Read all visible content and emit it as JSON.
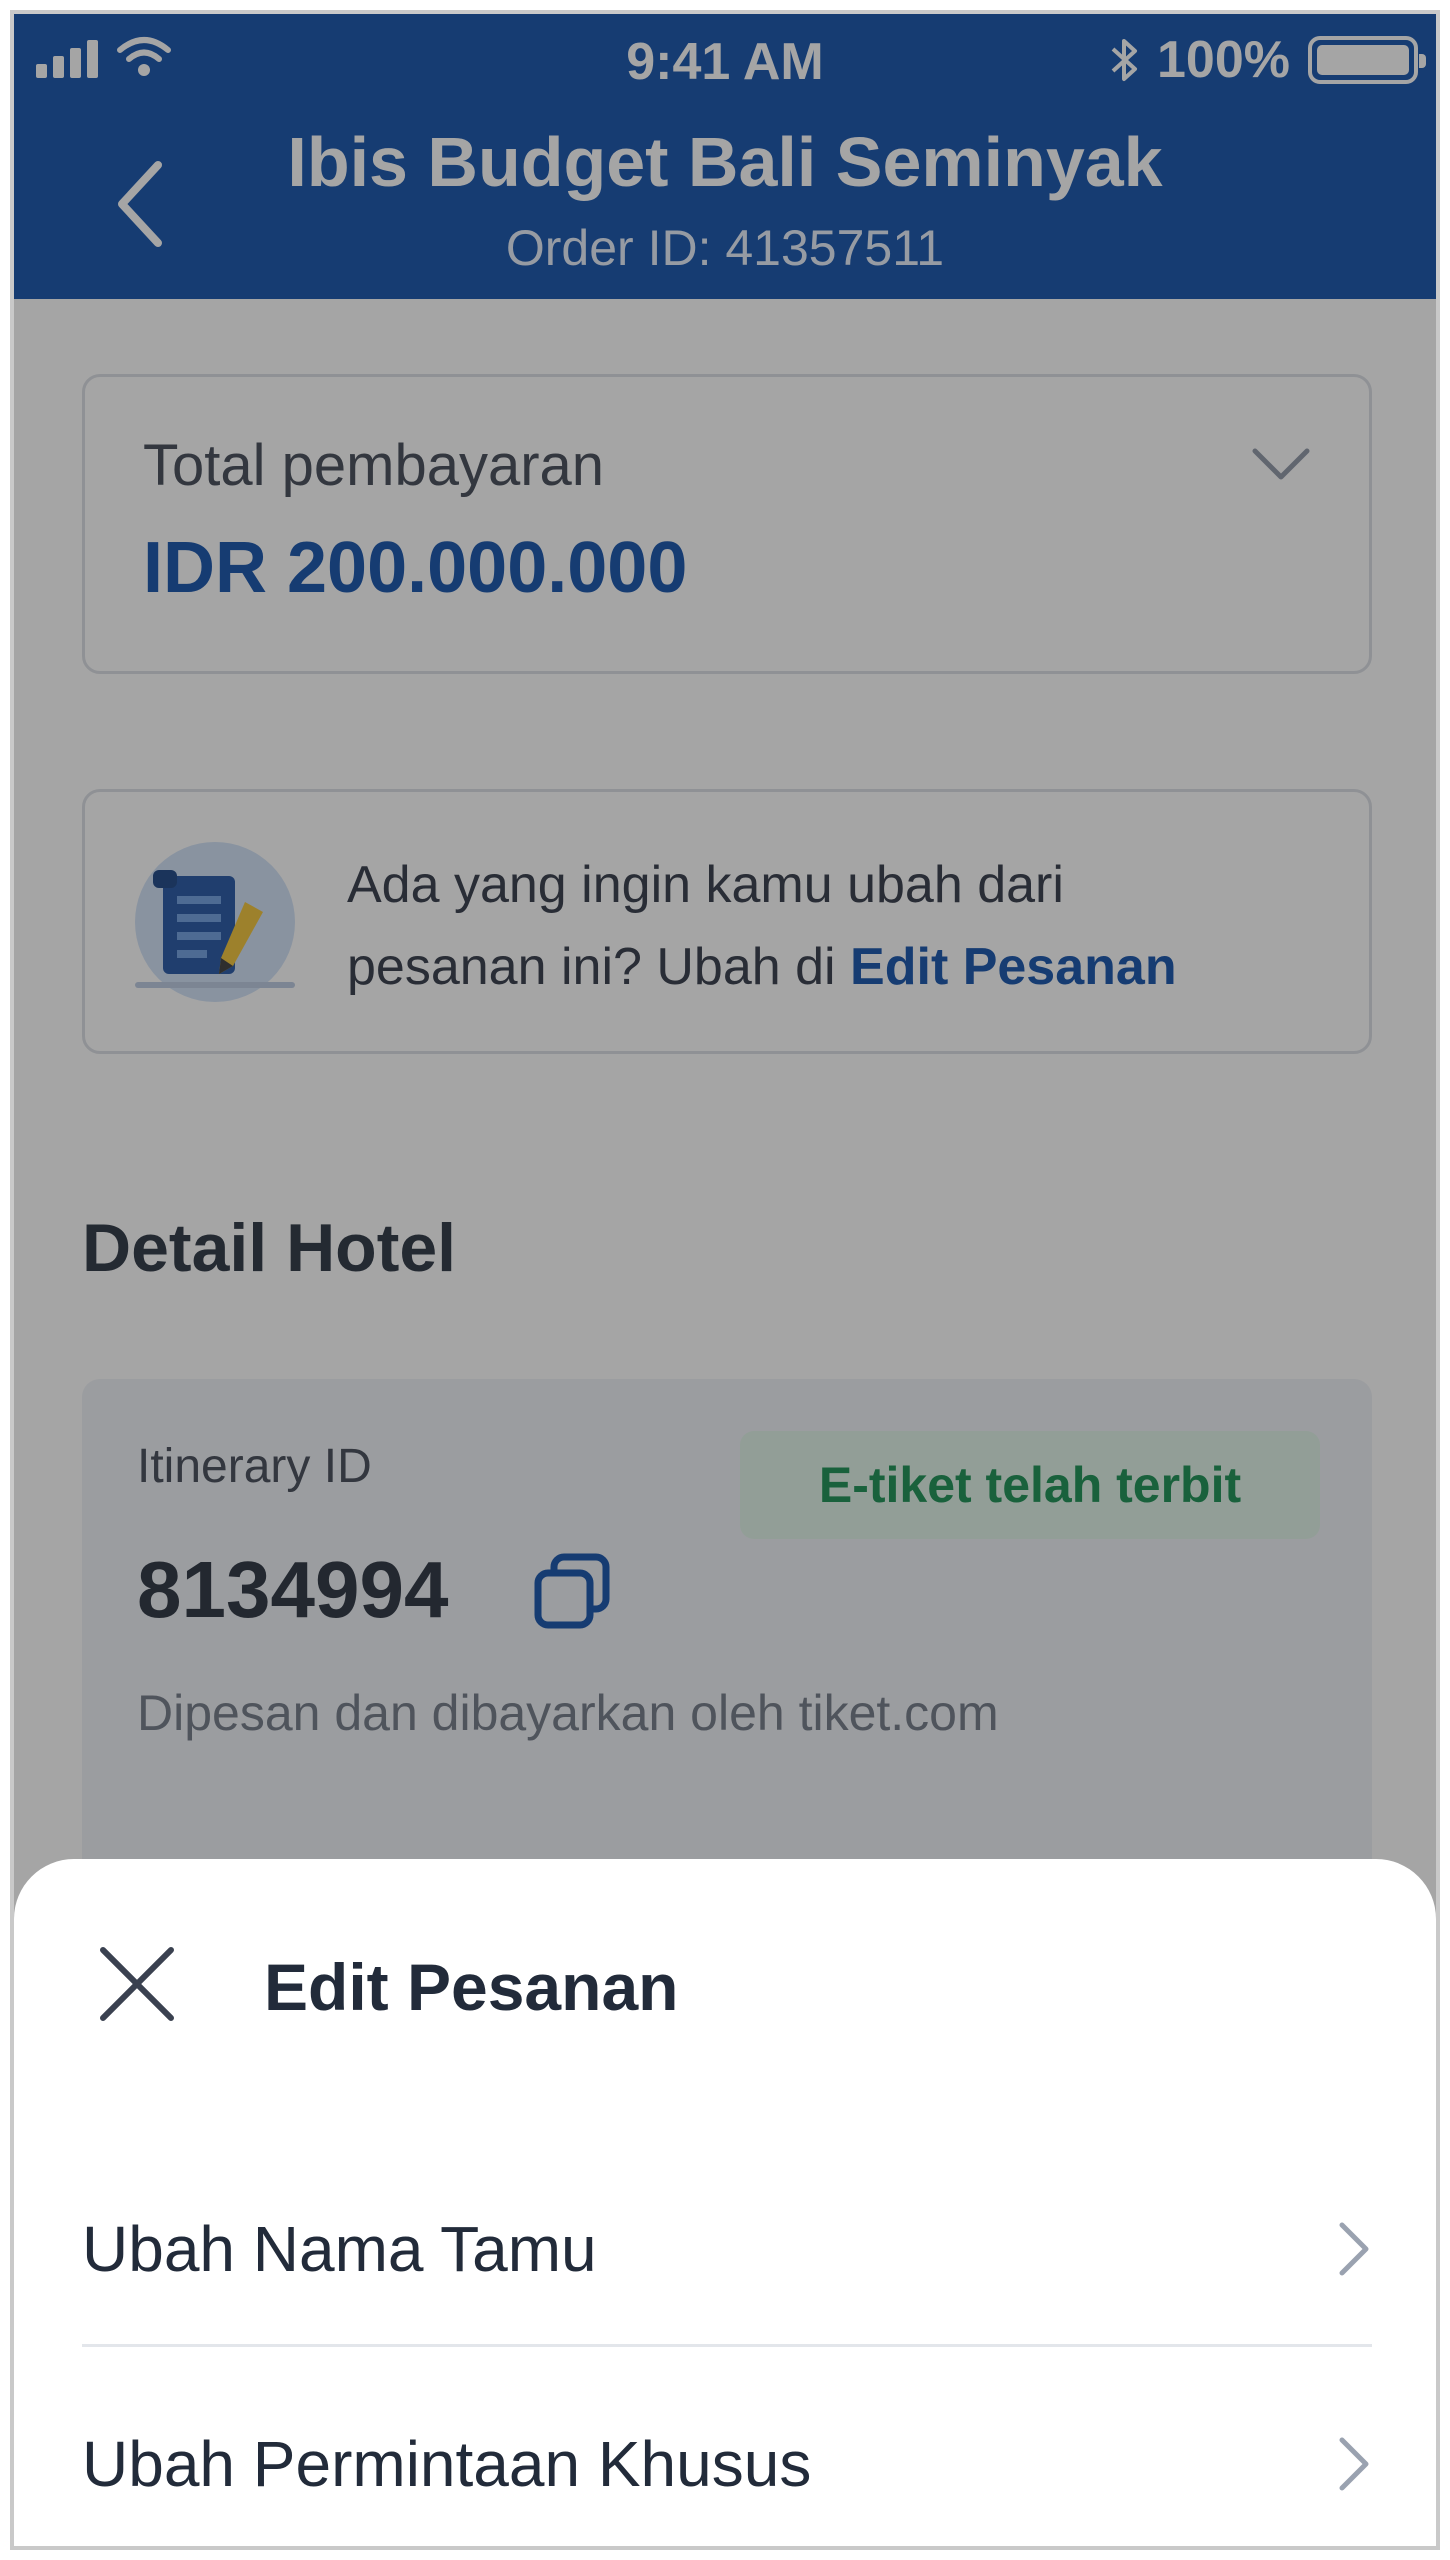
{
  "status_bar": {
    "time": "9:41 AM",
    "battery": "100%"
  },
  "header": {
    "title": "Ibis Budget Bali Seminyak",
    "order_id": "Order ID: 41357511"
  },
  "payment": {
    "label": "Total pembayaran",
    "amount": "IDR 200.000.000"
  },
  "edit_banner": {
    "text_line1": "Ada yang ingin kamu ubah dari",
    "text_line2": "pesanan ini? Ubah di ",
    "link": "Edit Pesanan"
  },
  "hotel_section": {
    "title": "Detail Hotel",
    "itinerary_label": "Itinerary ID",
    "itinerary_id": "8134994",
    "status_badge": "E-tiket telah terbit",
    "note": "Dipesan dan dibayarkan oleh tiket.com"
  },
  "sheet": {
    "title": "Edit Pesanan",
    "items": [
      {
        "label": "Ubah Nama Tamu",
        "icon": "chevron-right-icon"
      },
      {
        "label": "Ubah Permintaan Khusus",
        "icon": "chevron-right-icon"
      }
    ]
  },
  "colors": {
    "header": "#0a4ba8",
    "accent": "#0a4ba8",
    "badge_bg": "#dff3e7",
    "badge_text": "#0f8a4a"
  }
}
